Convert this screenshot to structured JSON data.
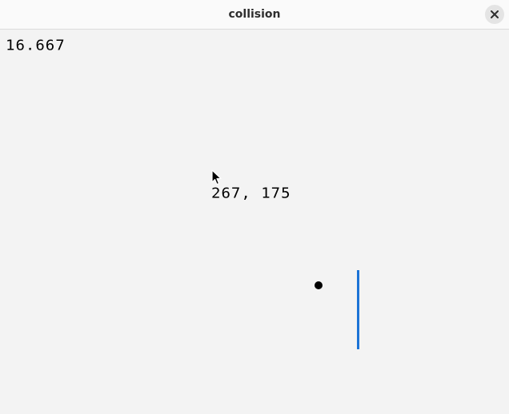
{
  "window": {
    "title": "collision",
    "close_icon": "close-icon"
  },
  "canvas": {
    "fps_readout": "16.667",
    "mouse_coords": "267, 175",
    "cursor_icon": "arrow-cursor-icon",
    "paddle_color": "#1b73d6",
    "ball_color": "#000000",
    "background_color": "#f3f3f3"
  }
}
